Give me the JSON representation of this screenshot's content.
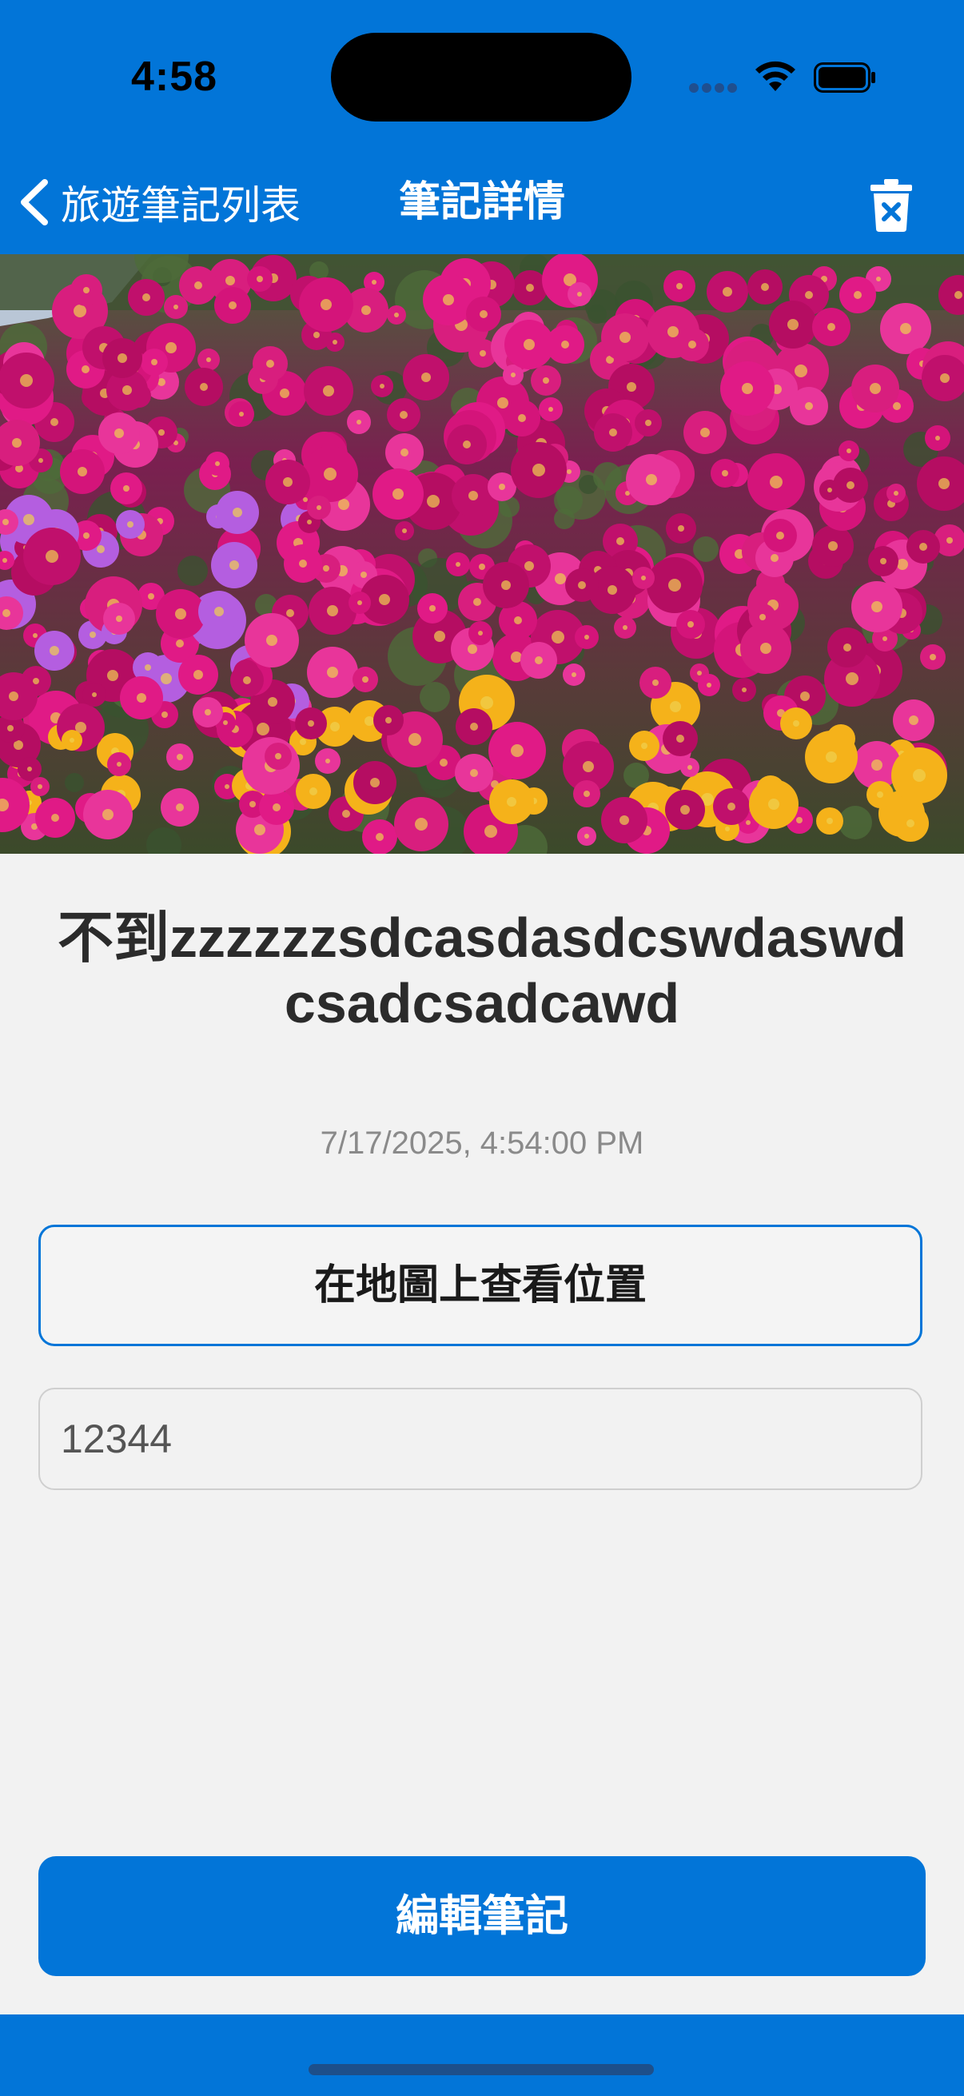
{
  "status_bar": {
    "time": "4:58"
  },
  "nav": {
    "back_label": "旅遊筆記列表",
    "title": "筆記詳情",
    "back_icon": "chevron-left-icon",
    "delete_icon": "trash-xmark-icon"
  },
  "note": {
    "title": "不到zzzzzzsdcasdasdcswdaswdcsadcsadcawd",
    "date": "7/17/2025, 4:54:00 PM",
    "content": "12344"
  },
  "actions": {
    "map_label": "在地圖上查看位置",
    "edit_label": "編輯筆記"
  },
  "colors": {
    "accent": "#0275d8",
    "background": "#f2f2f2",
    "title_text": "#2b2b2b",
    "date_text": "#8a8a8a"
  }
}
